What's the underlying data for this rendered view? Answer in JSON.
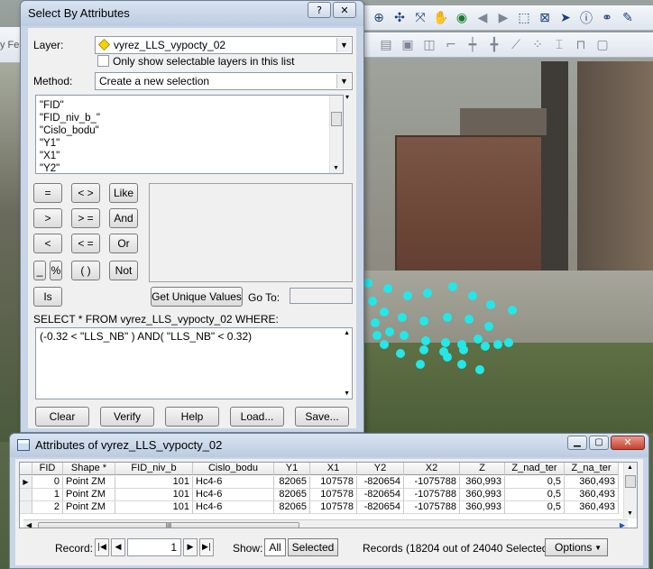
{
  "select_dialog": {
    "title": "Select By Attributes",
    "help_button": "?",
    "close_button": "✕",
    "layer_label": "Layer:",
    "layer_value": "vyrez_LLS_vypocty_02",
    "only_selectable_label": "Only show selectable layers in this list",
    "method_label": "Method:",
    "method_value": "Create a new selection",
    "fields": [
      "\"FID\"",
      "\"FID_niv_b_\"",
      "\"Cislo_bodu\"",
      "\"Y1\"",
      "\"X1\"",
      "\"Y2\""
    ],
    "operators": {
      "eq": "=",
      "ne": "< >",
      "like": "Like",
      "gt": ">",
      "ge": "> =",
      "and": "And",
      "lt": "<",
      "le": "< =",
      "or": "Or",
      "underscore": "_",
      "percent": "%",
      "parens": "( )",
      "not": "Not",
      "is": "Is"
    },
    "get_unique_values": "Get Unique Values",
    "goto_label": "Go To:",
    "sql_prefix": "SELECT * FROM vyrez_LLS_vypocty_02 WHERE:",
    "sql_expression": "(-0.32 < \"LLS_NB\" ) AND( \"LLS_NB\" < 0.32)",
    "buttons": {
      "clear": "Clear",
      "verify": "Verify",
      "help": "Help",
      "load": "Load...",
      "save": "Save..."
    }
  },
  "background": {
    "left_text": "y Fea"
  },
  "attributes_window": {
    "title": "Attributes of vyrez_LLS_vypocty_02",
    "columns": [
      "FID",
      "Shape *",
      "FID_niv_b",
      "Cislo_bodu",
      "Y1",
      "X1",
      "Y2",
      "X2",
      "Z",
      "Z_nad_ter",
      "Z_na_ter"
    ],
    "rows": [
      [
        "0",
        "Point ZM",
        "101",
        "Hc4-6",
        "82065",
        "107578",
        "-820654",
        "-1075788",
        "360,993",
        "0,5",
        "360,493"
      ],
      [
        "1",
        "Point ZM",
        "101",
        "Hc4-6",
        "82065",
        "107578",
        "-820654",
        "-1075788",
        "360,993",
        "0,5",
        "360,493"
      ],
      [
        "2",
        "Point ZM",
        "101",
        "Hc4-6",
        "82065",
        "107578",
        "-820654",
        "-1075788",
        "360,993",
        "0,5",
        "360,493"
      ]
    ],
    "record_label": "Record:",
    "record_value": "1",
    "show_label": "Show:",
    "show_all": "All",
    "show_selected": "Selected",
    "records_status": "Records (18204 out of 24040 Selected)",
    "options_button": "Options"
  },
  "colors": {
    "selection_points": "#22e8e8",
    "title_bar": "#c8d5e6"
  }
}
